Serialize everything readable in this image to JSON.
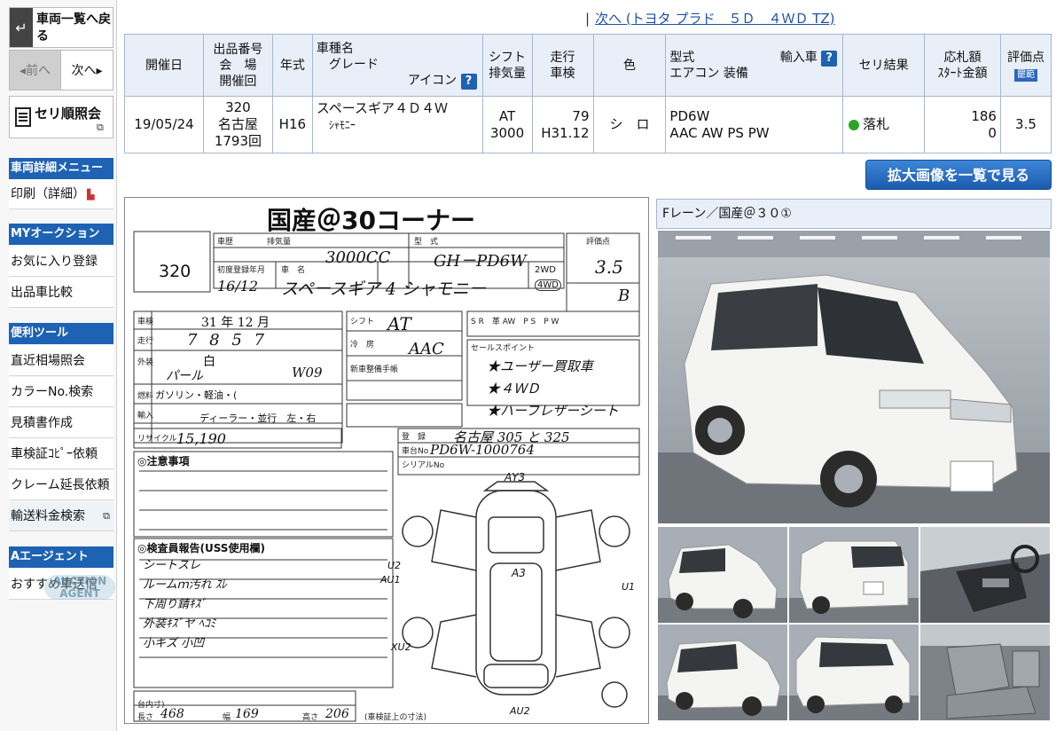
{
  "sidebar": {
    "back_label": "車両一覧へ戻る",
    "prev_label": "◂前へ",
    "next_label": "次へ▸",
    "seri_label": "セリ順照会",
    "menu_detail_header": "車両詳細メニュー",
    "print_label": "印刷（詳細）",
    "my_header": "MYオークション",
    "favorite_label": "お気に入り登録",
    "compare_label": "出品車比較",
    "tools_header": "便利ツール",
    "market_label": "直近相場照会",
    "color_label": "カラーNo.検索",
    "estimate_label": "見積書作成",
    "inspection_copy_label": "車検証ｺﾋﾟｰ依頼",
    "claim_label": "クレーム延長依頼",
    "transport_label": "輸送料金検索",
    "agent_header": "Aエージェント",
    "recommend_label": "おすすめ車送信",
    "logo_text": "AUCTION AGENT"
  },
  "top_nav": {
    "next_link": "次へ (トヨタ プラド　５Ｄ　４ＷＤ TZ)"
  },
  "info_table": {
    "headers": {
      "date": "開催日",
      "lot": [
        "出品番号",
        "会　場",
        "開催回"
      ],
      "year": "年式",
      "model": [
        "車種名",
        "グレード",
        "アイコン"
      ],
      "shift": [
        "シフト",
        "排気量"
      ],
      "mileage": [
        "走行",
        "車検"
      ],
      "color": "色",
      "type": [
        "型式",
        "輸入車",
        "エアコン 装備"
      ],
      "result": "セリ結果",
      "bid": [
        "応札額",
        "ｽﾀｰﾄ金額"
      ],
      "score": "評価点",
      "score_badge": "罷範"
    },
    "row": {
      "date": "19/05/24",
      "lot_no": "320",
      "venue": "名古屋",
      "session": "1793回",
      "year": "H16",
      "model": "スペースギア４Ｄ４Ｗ",
      "grade": "ｼｬﾓﾆｰ",
      "shift": "AT",
      "displacement": "3000",
      "mileage": "79",
      "inspection": "H31.12",
      "color": "シ　ロ",
      "model_code": "PD6W",
      "equipment": "AAC AW PS PW",
      "result": "落札",
      "bid_amount": "186",
      "start_amount": "0",
      "score": "3.5"
    }
  },
  "enlarge_button": "拡大画像を一覧で見る",
  "sheet": {
    "title": "国産＠30コーナー",
    "lot_no": "320",
    "displacement": "3000CC",
    "model_code": "GH－PD6W",
    "score": "3.5",
    "interior": "B",
    "first_reg": "16/12",
    "name_hand": "スペースギア 4 シャモニー",
    "drive": "4WD",
    "drive_2wd": "2WD",
    "shaken": "31 年 12 月",
    "mileage_hand": "7 8 5 7",
    "shift_hand": "AT",
    "ac_hand": "AAC",
    "color_orig": "白",
    "color_hand": "パール",
    "color_no": "W09",
    "fuel": "ガソリン・軽油・(",
    "handle": "ディーラー・並行　左・右",
    "recycle": "15,190",
    "reg_no": "名古屋 305 と 325",
    "chassis_no": "PD6W-1000764",
    "sales_points": [
      "★ユーザー買取車",
      "★４ＷＤ",
      "★ハーフレザーシート"
    ],
    "notes_header": "◎注意事項",
    "inspector_header": "◎検査員報告(USS使用欄)",
    "inspector_notes": [
      "シートスレ",
      "ルームｍ汚れ ｽﾚ",
      "下周り錆ｷｽﾞ",
      "外装ｷｽﾞヤ ﾍｺﾐ",
      "小キズ 小凹"
    ],
    "dims": {
      "length": "468",
      "width": "169",
      "height": "206"
    },
    "damage_marks": [
      "AY3",
      "A3",
      "U2",
      "AU1",
      "U1",
      "XU2",
      "AU2"
    ]
  },
  "photos": {
    "header": "Fレーン／国産＠３０①"
  }
}
